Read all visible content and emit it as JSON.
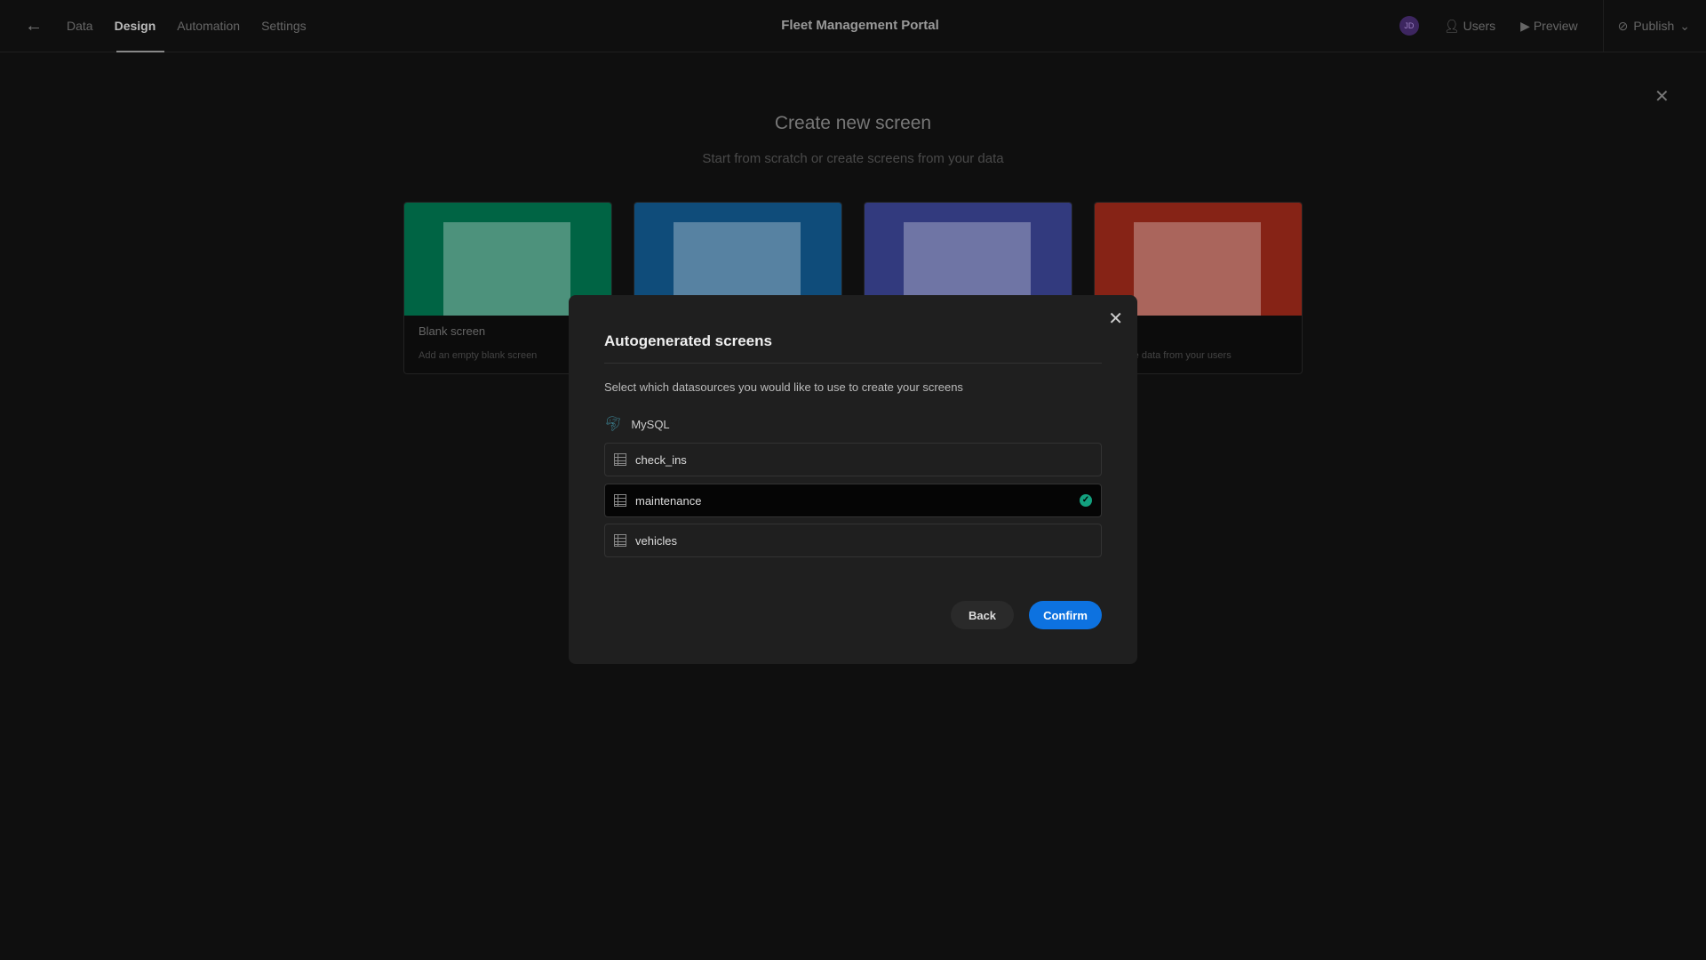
{
  "header": {
    "nav": [
      "Data",
      "Design",
      "Automation",
      "Settings"
    ],
    "active_nav": "Design",
    "app_title": "Fleet Management Portal",
    "avatar_initials": "JD",
    "users_label": "Users",
    "preview_label": "Preview",
    "publish_label": "Publish"
  },
  "page": {
    "title": "Create new screen",
    "subtitle": "Start from scratch or create screens from your data",
    "cards": [
      {
        "label": "Blank screen",
        "description": "Add an empty blank screen",
        "color": "#006444"
      },
      {
        "label": "",
        "description": "",
        "color": "#0f4c7a"
      },
      {
        "label": "",
        "description": "",
        "color": "#323a7e"
      },
      {
        "label": "",
        "description": "re data from your users",
        "color": "#862316"
      }
    ]
  },
  "modal": {
    "title": "Autogenerated screens",
    "description": "Select which datasources you would like to use to create your screens",
    "datasource": "MySQL",
    "tables": [
      {
        "name": "check_ins",
        "selected": false
      },
      {
        "name": "maintenance",
        "selected": true
      },
      {
        "name": "vehicles",
        "selected": false
      }
    ],
    "back_label": "Back",
    "confirm_label": "Confirm",
    "accent": "#0d72e0"
  }
}
